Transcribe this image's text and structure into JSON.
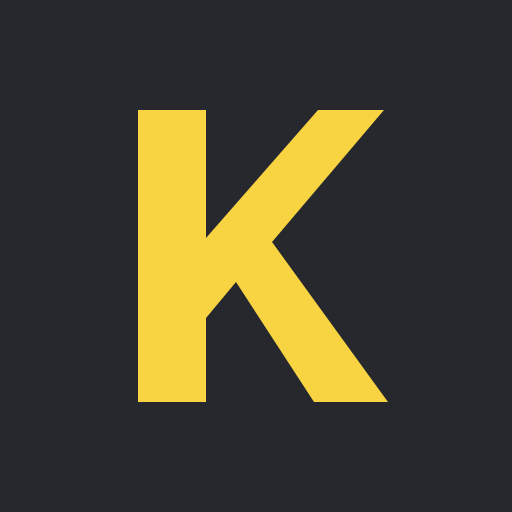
{
  "logo": {
    "letter": "K",
    "icon": "k-letter-logo-icon",
    "background_color": "#27282d",
    "letter_color": "#f8d442"
  }
}
